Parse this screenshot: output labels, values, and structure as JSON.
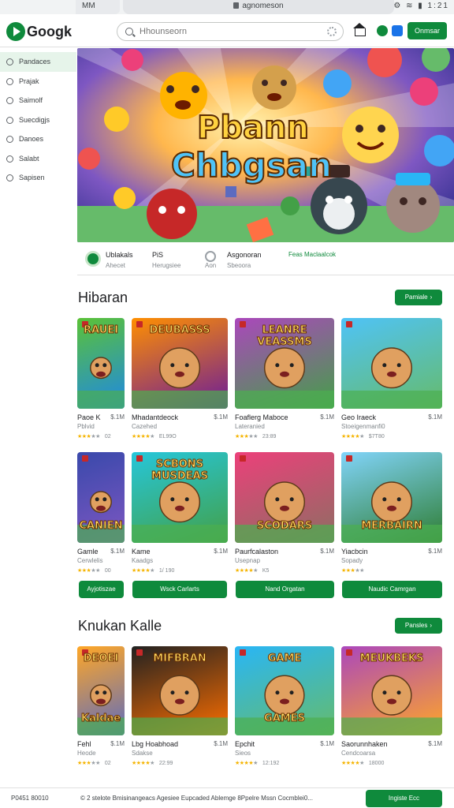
{
  "browser": {
    "tab_label": "MM",
    "url": "agnomeson",
    "status_icons": "⚙ ≋ ▮ 1:21"
  },
  "header": {
    "logo_text": "Googk",
    "search_placeholder": "Hhounseorn",
    "signin_label": "Onmsar"
  },
  "sidebar": {
    "items": [
      {
        "label": "Pandaces",
        "icon": "circle-icon",
        "active": true
      },
      {
        "label": "Prajak",
        "icon": "circle-icon",
        "active": false
      },
      {
        "label": "Saimolf",
        "icon": "circle-icon",
        "active": false
      },
      {
        "label": "Suecdigjs",
        "icon": "circle-icon",
        "active": false
      },
      {
        "label": "Danoes",
        "icon": "circle-icon",
        "active": false
      },
      {
        "label": "Salabt",
        "icon": "circle-icon",
        "active": false
      },
      {
        "label": "Sapisen",
        "icon": "circle-icon",
        "active": false
      }
    ]
  },
  "hero": {
    "title_line1": "Pbann",
    "title_line2": "Chbgsan"
  },
  "info_strip": {
    "item1_title": "Ublakals",
    "item1_sub": "Ahecet",
    "item2_title": "PiS",
    "item2_sub": "Herugsiee",
    "item3_title": "Asgonoran",
    "item3_sub": "Sbeoora",
    "item3_prefix": "Aon",
    "link": "Feas Maclaalcok"
  },
  "sections": [
    {
      "title": "Hibaran",
      "more_label": "Pamiale",
      "games": [
        {
          "title": "Paoe K",
          "size": "$.1M",
          "dev": "Pblvid",
          "stars": 3,
          "rating": "02",
          "thumb_top": "RAUEI",
          "thumb_bottom": "",
          "palette": [
            "#5bc236",
            "#1e88e5"
          ]
        },
        {
          "title": "Mhadantdeock",
          "size": "$.1M",
          "dev": "Cazehed",
          "stars": 4,
          "rating": "EL99O",
          "thumb_top": "DEUBASSS",
          "thumb_bottom": "",
          "palette": [
            "#ff8f00",
            "#6a1b9a"
          ]
        },
        {
          "title": "Foaflerg Maboce",
          "size": "$.1M",
          "dev": "Lateranied",
          "stars": 3,
          "rating": "23:89",
          "thumb_top": "LEANRE VEASSMS",
          "thumb_bottom": "",
          "palette": [
            "#ab47bc",
            "#43a047"
          ]
        },
        {
          "title": "Geo Iraeck",
          "size": "$.1M",
          "dev": "Stoeigenmanfi0",
          "stars": 4,
          "rating": "$7T80",
          "thumb_top": "",
          "thumb_bottom": "",
          "palette": [
            "#4fc3f7",
            "#66bb6a"
          ]
        }
      ],
      "games_row2": [
        {
          "title": "Gamle",
          "size": "$.1M",
          "dev": "Cerwlelis",
          "stars": 3,
          "rating": "00",
          "thumb_top": "",
          "thumb_bottom": "CANIEN",
          "palette": [
            "#3949ab",
            "#7e57c2"
          ]
        },
        {
          "title": "Kame",
          "size": "$.1M",
          "dev": "Kaadgs",
          "stars": 4,
          "rating": "1/ 190",
          "thumb_top": "SCBONS MUSDEAS",
          "thumb_bottom": "",
          "palette": [
            "#26c6da",
            "#43a047"
          ]
        },
        {
          "title": "Paurfcalaston",
          "size": "$.1M",
          "dev": "Usepnap",
          "stars": 4,
          "rating": "K5",
          "thumb_top": "",
          "thumb_bottom": "SCODARS",
          "palette": [
            "#ec407a",
            "#8d6e63"
          ]
        },
        {
          "title": "Yiacbcin",
          "size": "$.1M",
          "dev": "Sopady",
          "stars": 3,
          "rating": "",
          "thumb_top": "",
          "thumb_bottom": "MERBAIRN",
          "palette": [
            "#81d4fa",
            "#2e7d32"
          ]
        }
      ],
      "install_labels": [
        "Ayjotiszae",
        "Wsck Carlarts",
        "Nand Orgatan",
        "Naudic Camrgan"
      ]
    },
    {
      "title": "Knukan Kalle",
      "more_label": "Pansles",
      "games": [
        {
          "title": "Fehl",
          "size": "$.1M",
          "dev": "Heode",
          "stars": 3,
          "rating": "02",
          "thumb_top": "DEOEI",
          "thumb_bottom": "Kaldae",
          "palette": [
            "#ffa726",
            "#5c6bc0"
          ]
        },
        {
          "title": "Lbg Hoabhoad",
          "size": "$.1M",
          "dev": "Sdakse",
          "stars": 4,
          "rating": "22:99",
          "thumb_top": "MIFBRAN",
          "thumb_bottom": "",
          "palette": [
            "#212121",
            "#ff6f00"
          ]
        },
        {
          "title": "Epchit",
          "size": "$.1M",
          "dev": "Sieos",
          "stars": 4,
          "rating": "12:192",
          "thumb_top": "GAME",
          "thumb_bottom": "GAMES",
          "palette": [
            "#29b6f6",
            "#66bb6a"
          ]
        },
        {
          "title": "Saorunnhaken",
          "size": "$.1M",
          "dev": "Cendcoarsa",
          "stars": 4,
          "rating": "18000",
          "thumb_top": "MEUKBEKS",
          "thumb_bottom": "",
          "palette": [
            "#ab47bc",
            "#ffa726"
          ]
        }
      ]
    }
  ],
  "footer": {
    "version": "P0451 80010",
    "terms": "© 2 stelote Bmisinangeacs Agesiee Eupcaded Ablemge 8Ppelre Mssn Cocmblei0...",
    "button": "Ingiste Ecc"
  },
  "colors": {
    "accent": "#0f8a3c",
    "star": "#f5b400"
  }
}
